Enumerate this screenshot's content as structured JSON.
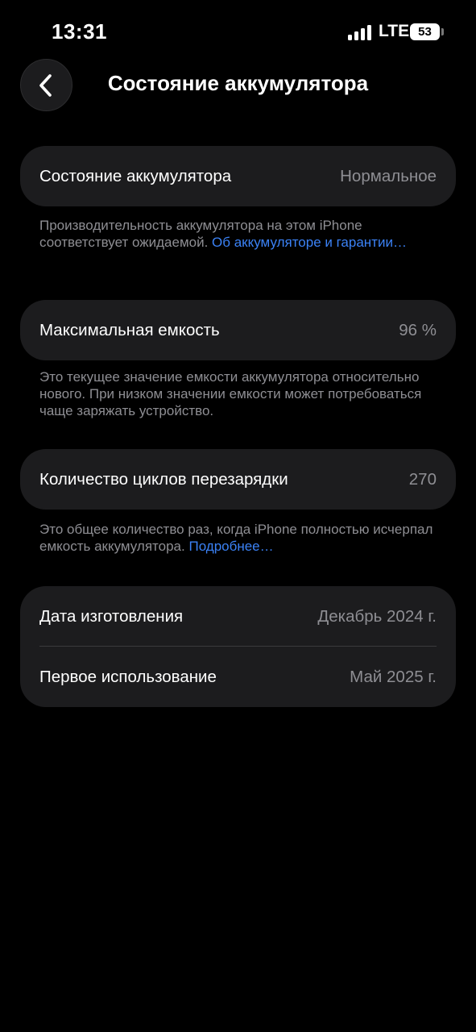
{
  "status_bar": {
    "time": "13:31",
    "network": "LTE",
    "battery": "53"
  },
  "header": {
    "title": "Состояние аккумулятора"
  },
  "sections": [
    {
      "label": "Состояние аккумулятора",
      "value": "Нормальное",
      "note": "Производительность аккумулятора на этом iPhone соответствует ожидаемой.",
      "note_link": "Об аккумуляторе и гарантии…"
    },
    {
      "label": "Максимальная емкость",
      "value": "96 %",
      "note": "Это текущее значение емкости аккумулятора относительно нового. При низком значении емкости может потребоваться чаще заряжать устройство."
    },
    {
      "label": "Количество циклов перезарядки",
      "value": "270",
      "note": "Это общее количество раз, когда iPhone полностью исчерпал емкость аккумулятора.",
      "note_link": "Подробнее…"
    }
  ],
  "dates": [
    {
      "label": "Дата изготовления",
      "value": "Декабрь 2024 г."
    },
    {
      "label": "Первое использование",
      "value": "Май 2025 г."
    }
  ],
  "colors": {
    "background": "#000000",
    "card": "#1c1c1e",
    "link": "#3b82f6",
    "secondary_text": "#8e8e93"
  }
}
